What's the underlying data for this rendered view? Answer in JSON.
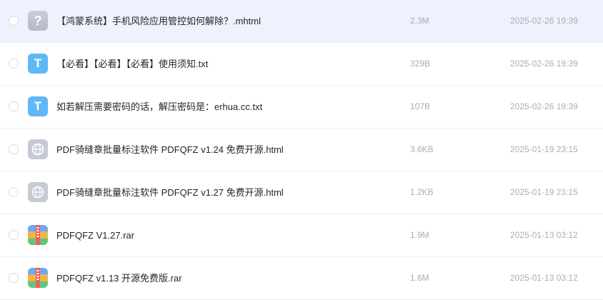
{
  "files": [
    {
      "name": "【鸿蒙系统】手机风险应用管控如何解除？.mhtml",
      "size": "2.3M",
      "date": "2025-02-26 19:39",
      "icon": "unknown-file-icon",
      "icon_glyph": "?",
      "selected": true
    },
    {
      "name": "【必看】【必看】【必看】使用须知.txt",
      "size": "329B",
      "date": "2025-02-26 19:39",
      "icon": "text-file-icon",
      "icon_glyph": "T",
      "selected": false
    },
    {
      "name": "如若解压需要密码的话，解压密码是：erhua.cc.txt",
      "size": "107B",
      "date": "2025-02-26 19:39",
      "icon": "text-file-icon",
      "icon_glyph": "T",
      "selected": false
    },
    {
      "name": "PDF骑缝章批量标注软件 PDFQFZ v1.24 免费开源.html",
      "size": "3.6KB",
      "date": "2025-01-19 23:15",
      "icon": "web-file-icon",
      "icon_glyph": "",
      "selected": false
    },
    {
      "name": "PDF骑缝章批量标注软件 PDFQFZ v1.27 免费开源.html",
      "size": "1.2KB",
      "date": "2025-01-19 23:15",
      "icon": "web-file-icon",
      "icon_glyph": "",
      "selected": false
    },
    {
      "name": "PDFQFZ V1.27.rar",
      "size": "1.9M",
      "date": "2025-01-13 03:12",
      "icon": "archive-file-icon",
      "icon_glyph": "",
      "selected": false
    },
    {
      "name": "PDFQFZ v1.13 开源免费版.rar",
      "size": "1.6M",
      "date": "2025-01-13 03:12",
      "icon": "archive-file-icon",
      "icon_glyph": "",
      "selected": false
    }
  ]
}
